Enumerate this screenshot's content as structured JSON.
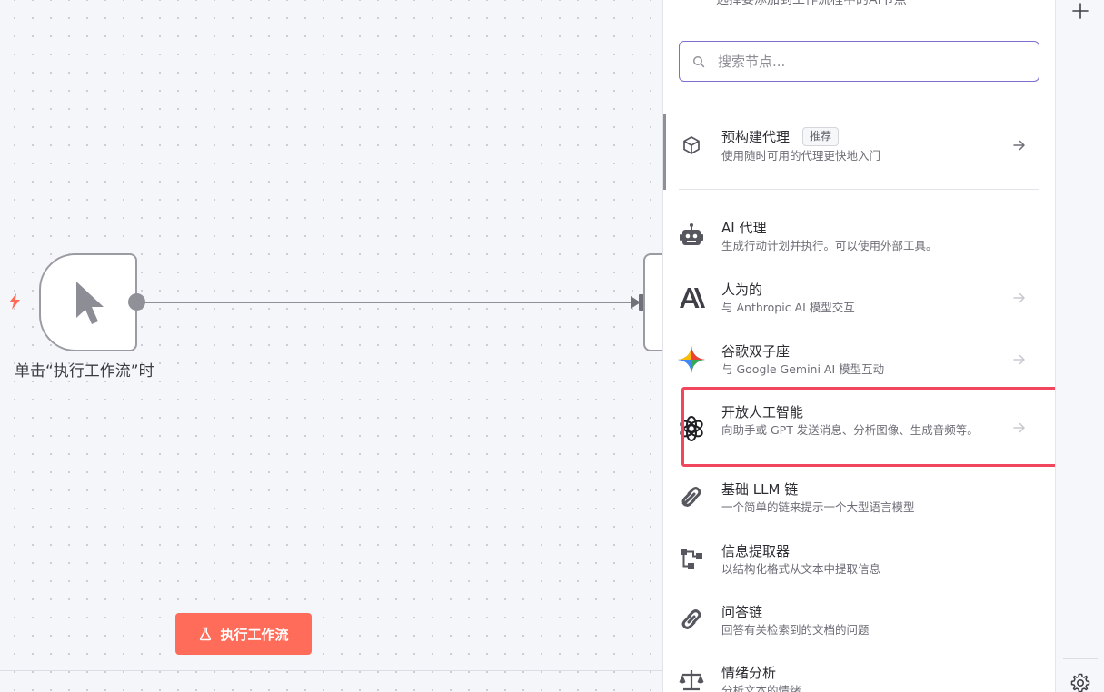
{
  "canvas": {
    "trigger_node": {
      "label": "单击“执行工作流”时",
      "icon": "mouse-pointer-icon"
    },
    "run_button": {
      "label": "执行工作流",
      "icon": "flask-icon"
    }
  },
  "panel": {
    "subtitle": "选择要添加到工作流程中的AI节点",
    "search": {
      "placeholder": "搜索节点...",
      "value": ""
    },
    "featured": {
      "title": "预构建代理",
      "badge": "推荐",
      "description": "使用随时可用的代理更快地入门",
      "icon": "cube-icon"
    },
    "items": [
      {
        "title": "AI 代理",
        "description": "生成行动计划并执行。可以使用外部工具。",
        "icon": "robot-icon"
      },
      {
        "title": "人为的",
        "description": "与 Anthropic AI 模型交互",
        "icon": "anthropic-logo-icon"
      },
      {
        "title": "谷歌双子座",
        "description": "与 Google Gemini AI 模型互动",
        "icon": "gemini-star-icon"
      },
      {
        "title": "开放人工智能",
        "description": "向助手或 GPT 发送消息、分析图像、生成音频等。",
        "icon": "openai-logo-icon"
      },
      {
        "title": "基础 LLM 链",
        "description": "一个简单的链来提示一个大型语言模型",
        "icon": "link-icon"
      },
      {
        "title": "信息提取器",
        "description": "以结构化格式从文本中提取信息",
        "icon": "tree-structure-icon"
      },
      {
        "title": "问答链",
        "description": "回答有关检索到的文档的问题",
        "icon": "link-icon"
      },
      {
        "title": "情绪分析",
        "description": "分析文本的情绪",
        "icon": "balance-scale-icon"
      }
    ]
  },
  "colors": {
    "accent": "#ff6d5a",
    "search_border": "#7b6fcf",
    "highlight": "#f2465e"
  }
}
